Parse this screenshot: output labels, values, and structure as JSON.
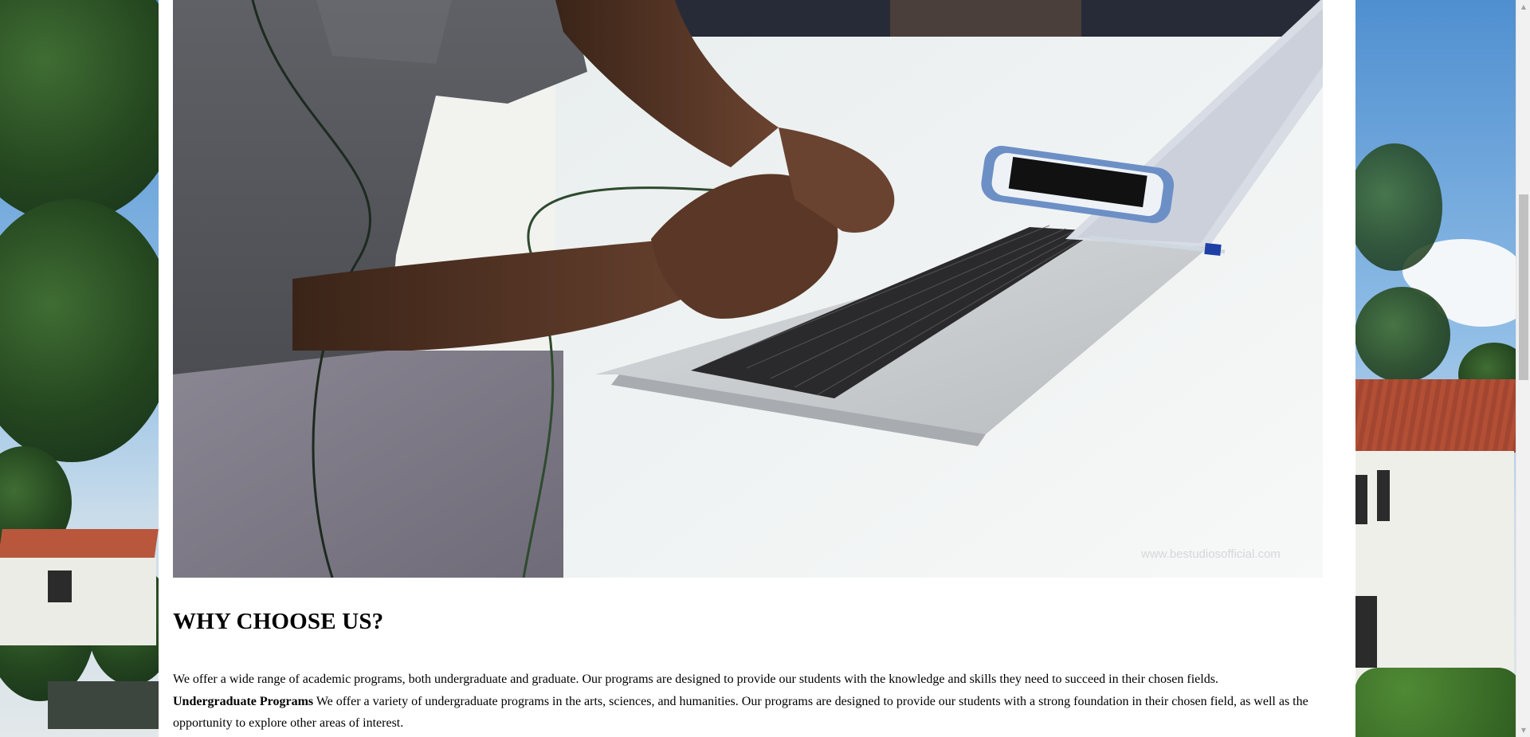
{
  "hero_image": {
    "alt": "Person typing on a laptop at a white desk",
    "watermark": "www.bestudiosofficial.com"
  },
  "why_choose_us": {
    "heading": "WHY CHOOSE US?",
    "intro": "We offer a wide range of academic programs, both undergraduate and graduate. Our programs are designed to provide our students with the knowledge and skills they need to succeed in their chosen fields.",
    "undergrad_label": "Undergraduate Programs",
    "undergrad_text": " We offer a variety of undergraduate programs in the arts, sciences, and humanities. Our programs are designed to provide our students with a strong foundation in their chosen field, as well as the opportunity to explore other areas of interest."
  },
  "scrollbar": {
    "up_icon": "triangle-up",
    "down_icon": "triangle-down"
  },
  "colors": {
    "panel": "#ffffff",
    "heading_text": "#000000",
    "scrollbar_track": "#f1f1f1",
    "scrollbar_thumb": "#c1c1c1"
  }
}
